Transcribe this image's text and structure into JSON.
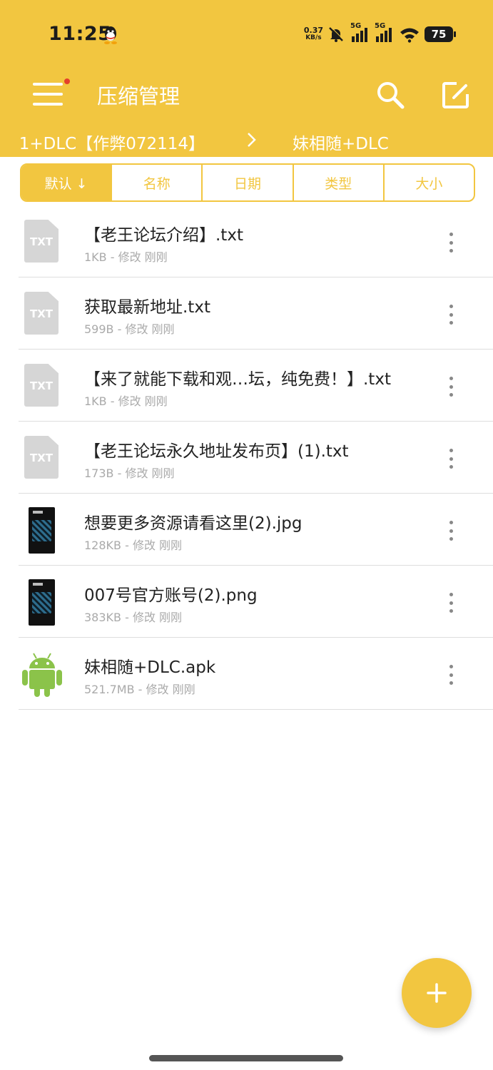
{
  "status_bar": {
    "time": "11:25",
    "net_speed": "0.37",
    "net_unit": "KB/s",
    "sim1_label": "5G",
    "sim2_label": "5G",
    "battery": "75"
  },
  "app_bar": {
    "title": "压缩管理"
  },
  "breadcrumb": {
    "parent": "1+DLC【作弊072114】",
    "current": "妹相随+DLC"
  },
  "sort_tabs": [
    {
      "label": "默认 ↓",
      "active": true
    },
    {
      "label": "名称",
      "active": false
    },
    {
      "label": "日期",
      "active": false
    },
    {
      "label": "类型",
      "active": false
    },
    {
      "label": "大小",
      "active": false
    }
  ],
  "files": [
    {
      "name": "【老王论坛介绍】.txt",
      "meta": "1KB - 修改 刚刚",
      "icon": "txt-file-icon",
      "icon_label": "TXT"
    },
    {
      "name": "获取最新地址.txt",
      "meta": "599B - 修改 刚刚",
      "icon": "txt-file-icon",
      "icon_label": "TXT"
    },
    {
      "name": "【来了就能下载和观…坛，纯免费！】.txt",
      "meta": "1KB - 修改 刚刚",
      "icon": "txt-file-icon",
      "icon_label": "TXT"
    },
    {
      "name": "【老王论坛永久地址发布页】(1).txt",
      "meta": "173B - 修改 刚刚",
      "icon": "txt-file-icon",
      "icon_label": "TXT"
    },
    {
      "name": "想要更多资源请看这里(2).jpg",
      "meta": "128KB - 修改 刚刚",
      "icon": "image-thumbnail"
    },
    {
      "name": "007号官方账号(2).png",
      "meta": "383KB - 修改 刚刚",
      "icon": "image-thumbnail"
    },
    {
      "name": "妹相随+DLC.apk",
      "meta": "521.7MB - 修改 刚刚",
      "icon": "android-icon"
    }
  ],
  "colors": {
    "accent": "#f2c640",
    "notification_dot": "#e4402b",
    "android_green": "#8bc34a"
  }
}
